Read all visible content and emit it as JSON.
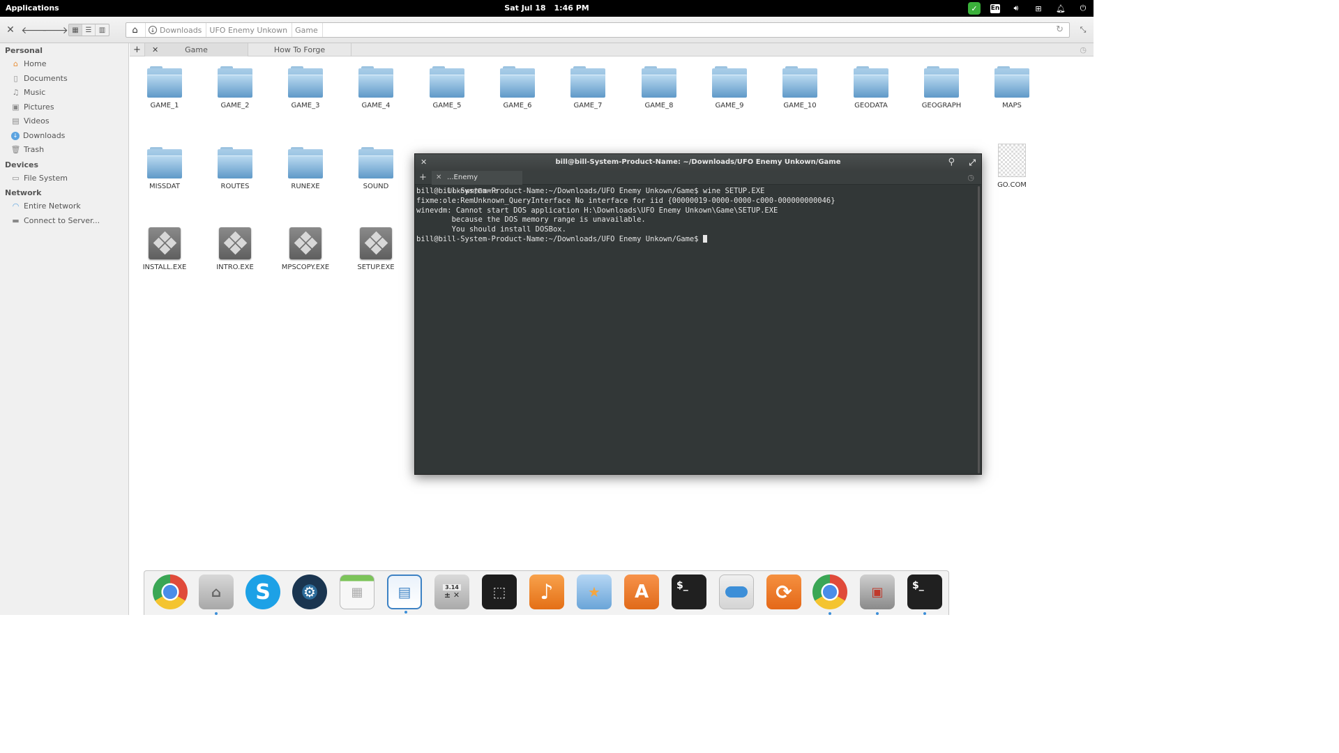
{
  "top_panel": {
    "applications": "Applications",
    "date": "Sat Jul 18",
    "time": "1:46 PM",
    "keyboard_layout": "En"
  },
  "toolbar": {
    "breadcrumbs": [
      "Downloads",
      "UFO Enemy Unkown",
      "Game"
    ]
  },
  "sidebar": {
    "personal_header": "Personal",
    "personal": [
      "Home",
      "Documents",
      "Music",
      "Pictures",
      "Videos",
      "Downloads",
      "Trash"
    ],
    "devices_header": "Devices",
    "devices": [
      "File System"
    ],
    "network_header": "Network",
    "network": [
      "Entire Network",
      "Connect to Server..."
    ]
  },
  "tabs": [
    "Game",
    "How To Forge"
  ],
  "files": {
    "row1": [
      "GAME_1",
      "GAME_2",
      "GAME_3",
      "GAME_4",
      "GAME_5",
      "GAME_6",
      "GAME_7",
      "GAME_8",
      "GAME_9",
      "GAME_10",
      "GEODATA",
      "GEOGRAPH",
      "MAPS"
    ],
    "row2": [
      "MISSDAT",
      "ROUTES",
      "RUNEXE",
      "SOUND"
    ],
    "row2_right": "GO.COM",
    "row3": [
      "INSTALL.EXE",
      "INTRO.EXE",
      "MPSCOPY.EXE",
      "SETUP.EXE"
    ]
  },
  "terminal": {
    "title": "bill@bill-System-Product-Name: ~/Downloads/UFO Enemy Unkown/Game",
    "tab": "...Enemy Unkown/Game",
    "lines": [
      "bill@bill-System-Product-Name:~/Downloads/UFO Enemy Unkown/Game$ wine SETUP.EXE",
      "fixme:ole:RemUnknown_QueryInterface No interface for iid {00000019-0000-0000-c000-000000000046}",
      "winevdm: Cannot start DOS application H:\\Downloads\\UFO Enemy Unkown\\Game\\SETUP.EXE",
      "        because the DOS memory range is unavailable.",
      "        You should install DOSBox."
    ],
    "prompt": "bill@bill-System-Product-Name:~/Downloads/UFO Enemy Unkown/Game$ "
  },
  "dock": [
    "chrome",
    "files",
    "skype",
    "steam",
    "calendar",
    "office-writer",
    "calculator",
    "screenshot",
    "music",
    "photos",
    "app-center",
    "terminal",
    "switchboard",
    "updater",
    "chrome-2",
    "backup",
    "terminal-2"
  ],
  "dock_calc_display": "3.14"
}
